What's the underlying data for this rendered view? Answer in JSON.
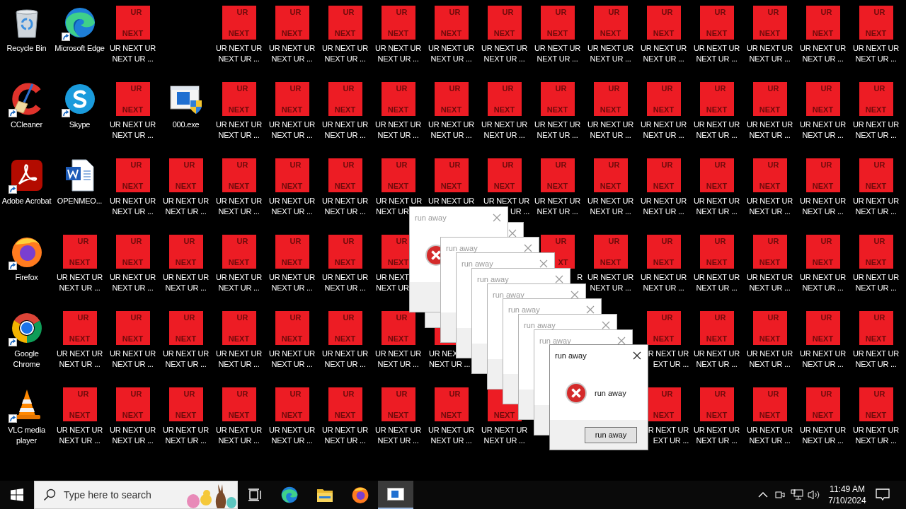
{
  "desktop": {
    "rows": [
      [
        {
          "kind": "recycle",
          "label": "Recycle Bin",
          "shortcut": false
        },
        {
          "kind": "edge",
          "label": "Microsoft Edge",
          "shortcut": true
        },
        {
          "kind": "ur",
          "badge_top": "UR",
          "badge_bottom": "NEXT",
          "label": "UR NEXT UR NEXT UR ...",
          "shortcut": false
        },
        null,
        {
          "kind": "ur",
          "badge_top": "UR",
          "badge_bottom": "NEXT",
          "label": "UR NEXT UR NEXT UR ...",
          "shortcut": false
        },
        {
          "kind": "ur",
          "badge_top": "UR",
          "badge_bottom": "NEXT",
          "label": "UR NEXT UR NEXT UR ...",
          "shortcut": false
        },
        {
          "kind": "ur",
          "badge_top": "UR",
          "badge_bottom": "NEXT",
          "label": "UR NEXT UR NEXT UR ...",
          "shortcut": false
        },
        {
          "kind": "ur",
          "badge_top": "UR",
          "badge_bottom": "NEXT",
          "label": "UR NEXT UR NEXT UR ...",
          "shortcut": false
        },
        {
          "kind": "ur",
          "badge_top": "UR",
          "badge_bottom": "NEXT",
          "label": "UR NEXT UR NEXT UR ...",
          "shortcut": false
        },
        {
          "kind": "ur",
          "badge_top": "UR",
          "badge_bottom": "NEXT",
          "label": "UR NEXT UR NEXT UR ...",
          "shortcut": false
        },
        {
          "kind": "ur",
          "badge_top": "UR",
          "badge_bottom": "NEXT",
          "label": "UR NEXT UR NEXT UR ...",
          "shortcut": false
        },
        {
          "kind": "ur",
          "badge_top": "UR",
          "badge_bottom": "NEXT",
          "label": "UR NEXT UR NEXT UR ...",
          "shortcut": false
        },
        {
          "kind": "ur",
          "badge_top": "UR",
          "badge_bottom": "NEXT",
          "label": "UR NEXT UR NEXT UR ...",
          "shortcut": false
        },
        {
          "kind": "ur",
          "badge_top": "UR",
          "badge_bottom": "NEXT",
          "label": "UR NEXT UR NEXT UR ...",
          "shortcut": false
        },
        {
          "kind": "ur",
          "badge_top": "UR",
          "badge_bottom": "NEXT",
          "label": "UR NEXT UR NEXT UR ...",
          "shortcut": false
        },
        {
          "kind": "ur",
          "badge_top": "UR",
          "badge_bottom": "NEXT",
          "label": "UR NEXT UR NEXT UR ...",
          "shortcut": false
        },
        {
          "kind": "ur",
          "badge_top": "UR",
          "badge_bottom": "NEXT",
          "label": "UR NEXT UR NEXT UR ...",
          "shortcut": false
        }
      ],
      [
        {
          "kind": "ccleaner",
          "label": "CCleaner",
          "shortcut": true
        },
        {
          "kind": "skype",
          "label": "Skype",
          "shortcut": true
        },
        {
          "kind": "ur",
          "badge_top": "UR",
          "badge_bottom": "NEXT",
          "label": "UR NEXT UR NEXT UR ...",
          "shortcut": false
        },
        {
          "kind": "exe",
          "label": "000.exe",
          "shortcut": false
        },
        {
          "kind": "ur",
          "badge_top": "UR",
          "badge_bottom": "NEXT",
          "label": "UR NEXT UR NEXT UR ...",
          "shortcut": false
        },
        {
          "kind": "ur",
          "badge_top": "UR",
          "badge_bottom": "NEXT",
          "label": "UR NEXT UR NEXT UR ...",
          "shortcut": false
        },
        {
          "kind": "ur",
          "badge_top": "UR",
          "badge_bottom": "NEXT",
          "label": "UR NEXT UR NEXT UR ...",
          "shortcut": false
        },
        {
          "kind": "ur",
          "badge_top": "UR",
          "badge_bottom": "NEXT",
          "label": "UR NEXT UR NEXT UR ...",
          "shortcut": false
        },
        {
          "kind": "ur",
          "badge_top": "UR",
          "badge_bottom": "NEXT",
          "label": "UR NEXT UR NEXT UR ...",
          "shortcut": false
        },
        {
          "kind": "ur",
          "badge_top": "UR",
          "badge_bottom": "NEXT",
          "label": "UR NEXT UR NEXT UR ...",
          "shortcut": false
        },
        {
          "kind": "ur",
          "badge_top": "UR",
          "badge_bottom": "NEXT",
          "label": "UR NEXT UR NEXT UR ...",
          "shortcut": false
        },
        {
          "kind": "ur",
          "badge_top": "UR",
          "badge_bottom": "NEXT",
          "label": "UR NEXT UR NEXT UR ...",
          "shortcut": false
        },
        {
          "kind": "ur",
          "badge_top": "UR",
          "badge_bottom": "NEXT",
          "label": "UR NEXT UR NEXT UR ...",
          "shortcut": false
        },
        {
          "kind": "ur",
          "badge_top": "UR",
          "badge_bottom": "NEXT",
          "label": "UR NEXT UR NEXT UR ...",
          "shortcut": false
        },
        {
          "kind": "ur",
          "badge_top": "UR",
          "badge_bottom": "NEXT",
          "label": "UR NEXT UR NEXT UR ...",
          "shortcut": false
        },
        {
          "kind": "ur",
          "badge_top": "UR",
          "badge_bottom": "NEXT",
          "label": "UR NEXT UR NEXT UR ...",
          "shortcut": false
        },
        {
          "kind": "ur",
          "badge_top": "UR",
          "badge_bottom": "NEXT",
          "label": "UR NEXT UR NEXT UR ...",
          "shortcut": false
        }
      ],
      [
        {
          "kind": "acrobat",
          "label": "Adobe Acrobat",
          "shortcut": true
        },
        {
          "kind": "word",
          "label": "OPENMEO...",
          "shortcut": false
        },
        {
          "kind": "ur",
          "badge_top": "UR",
          "badge_bottom": "NEXT",
          "label": "UR NEXT UR NEXT UR ...",
          "shortcut": false
        },
        {
          "kind": "ur",
          "badge_top": "UR",
          "badge_bottom": "NEXT",
          "label": "UR NEXT UR NEXT UR ...",
          "shortcut": false
        },
        {
          "kind": "ur",
          "badge_top": "UR",
          "badge_bottom": "NEXT",
          "label": "UR NEXT UR NEXT UR ...",
          "shortcut": false
        },
        {
          "kind": "ur",
          "badge_top": "UR",
          "badge_bottom": "NEXT",
          "label": "UR NEXT UR NEXT UR ...",
          "shortcut": false
        },
        {
          "kind": "ur",
          "badge_top": "UR",
          "badge_bottom": "NEXT",
          "label": "UR NEXT UR NEXT UR ...",
          "shortcut": false
        },
        {
          "kind": "ur",
          "badge_top": "UR",
          "badge_bottom": "NEXT",
          "label": "UR NEXT UR\nNEXT UR",
          "shortcut": false
        },
        {
          "kind": "ur",
          "badge_top": "UR",
          "badge_bottom": "NEXT",
          "label": "UR NEXT UR",
          "shortcut": false
        },
        {
          "kind": "ur",
          "badge_top": "UR",
          "badge_bottom": "NEXT",
          "label": "UR NEXT UR\nUR ...",
          "shortcut": false
        },
        {
          "kind": "ur",
          "badge_top": "UR",
          "badge_bottom": "NEXT",
          "label": "UR NEXT UR NEXT UR ...",
          "shortcut": false
        },
        {
          "kind": "ur",
          "badge_top": "UR",
          "badge_bottom": "NEXT",
          "label": "UR NEXT UR NEXT UR ...",
          "shortcut": false
        },
        {
          "kind": "ur",
          "badge_top": "UR",
          "badge_bottom": "NEXT",
          "label": "UR NEXT UR NEXT UR ...",
          "shortcut": false
        },
        {
          "kind": "ur",
          "badge_top": "UR",
          "badge_bottom": "NEXT",
          "label": "UR NEXT UR NEXT UR ...",
          "shortcut": false
        },
        {
          "kind": "ur",
          "badge_top": "UR",
          "badge_bottom": "NEXT",
          "label": "UR NEXT UR NEXT UR ...",
          "shortcut": false
        },
        {
          "kind": "ur",
          "badge_top": "UR",
          "badge_bottom": "NEXT",
          "label": "UR NEXT UR NEXT UR ...",
          "shortcut": false
        },
        {
          "kind": "ur",
          "badge_top": "UR",
          "badge_bottom": "NEXT",
          "label": "UR NEXT UR NEXT UR ...",
          "shortcut": false
        }
      ],
      [
        {
          "kind": "firefox",
          "label": "Firefox",
          "shortcut": true
        },
        {
          "kind": "ur",
          "badge_top": "UR",
          "badge_bottom": "NEXT",
          "label": "UR NEXT UR NEXT UR ...",
          "shortcut": false
        },
        {
          "kind": "ur",
          "badge_top": "UR",
          "badge_bottom": "NEXT",
          "label": "UR NEXT UR NEXT UR ...",
          "shortcut": false
        },
        {
          "kind": "ur",
          "badge_top": "UR",
          "badge_bottom": "NEXT",
          "label": "UR NEXT UR NEXT UR ...",
          "shortcut": false
        },
        {
          "kind": "ur",
          "badge_top": "UR",
          "badge_bottom": "NEXT",
          "label": "UR NEXT UR NEXT UR ...",
          "shortcut": false
        },
        {
          "kind": "ur",
          "badge_top": "UR",
          "badge_bottom": "NEXT",
          "label": "UR NEXT UR NEXT UR ...",
          "shortcut": false
        },
        {
          "kind": "ur",
          "badge_top": "UR",
          "badge_bottom": "NEXT",
          "label": "UR NEXT UR NEXT UR ...",
          "shortcut": false
        },
        {
          "kind": "ur",
          "badge_top": "UR",
          "badge_bottom": "NEXT",
          "label": "UR NEXT\nNEXT UR",
          "shortcut": false
        },
        null,
        null,
        {
          "kind": "ur",
          "badge_top": "UR",
          "badge_bottom": "XT",
          "label": "R",
          "shortcut": false
        },
        {
          "kind": "ur",
          "badge_top": "UR",
          "badge_bottom": "NEXT",
          "label": "UR NEXT UR NEXT UR ...",
          "shortcut": false
        },
        {
          "kind": "ur",
          "badge_top": "UR",
          "badge_bottom": "NEXT",
          "label": "UR NEXT UR NEXT UR ...",
          "shortcut": false
        },
        {
          "kind": "ur",
          "badge_top": "UR",
          "badge_bottom": "NEXT",
          "label": "UR NEXT UR NEXT UR ...",
          "shortcut": false
        },
        {
          "kind": "ur",
          "badge_top": "UR",
          "badge_bottom": "NEXT",
          "label": "UR NEXT UR NEXT UR ...",
          "shortcut": false
        },
        {
          "kind": "ur",
          "badge_top": "UR",
          "badge_bottom": "NEXT",
          "label": "UR NEXT UR NEXT UR ...",
          "shortcut": false
        },
        {
          "kind": "ur",
          "badge_top": "UR",
          "badge_bottom": "NEXT",
          "label": "UR NEXT UR NEXT UR ...",
          "shortcut": false
        }
      ],
      [
        {
          "kind": "chrome",
          "label": "Google Chrome",
          "shortcut": true
        },
        {
          "kind": "ur",
          "badge_top": "UR",
          "badge_bottom": "NEXT",
          "label": "UR NEXT UR NEXT UR ...",
          "shortcut": false
        },
        {
          "kind": "ur",
          "badge_top": "UR",
          "badge_bottom": "NEXT",
          "label": "UR NEXT UR NEXT UR ...",
          "shortcut": false
        },
        {
          "kind": "ur",
          "badge_top": "UR",
          "badge_bottom": "NEXT",
          "label": "UR NEXT UR NEXT UR ...",
          "shortcut": false
        },
        {
          "kind": "ur",
          "badge_top": "UR",
          "badge_bottom": "NEXT",
          "label": "UR NEXT UR NEXT UR ...",
          "shortcut": false
        },
        {
          "kind": "ur",
          "badge_top": "UR",
          "badge_bottom": "NEXT",
          "label": "UR NEXT UR NEXT UR ...",
          "shortcut": false
        },
        {
          "kind": "ur",
          "badge_top": "UR",
          "badge_bottom": "NEXT",
          "label": "UR NEXT UR NEXT UR ...",
          "shortcut": false
        },
        {
          "kind": "ur",
          "badge_top": "UR",
          "badge_bottom": "NEXT",
          "label": "UR NEXT UR NEXT UR ...",
          "shortcut": false
        },
        {
          "kind": "ur",
          "label": "UR NEX\nNEXT UR ...",
          "shortcut": false
        },
        null,
        null,
        null,
        {
          "kind": "ur",
          "badge_top": "UR",
          "badge_bottom": "NEXT",
          "label": "R NEXT UR\nEXT UR ...",
          "shortcut": false
        },
        {
          "kind": "ur",
          "badge_top": "UR",
          "badge_bottom": "NEXT",
          "label": "UR NEXT UR NEXT UR ...",
          "shortcut": false
        },
        {
          "kind": "ur",
          "badge_top": "UR",
          "badge_bottom": "NEXT",
          "label": "UR NEXT UR NEXT UR ...",
          "shortcut": false
        },
        {
          "kind": "ur",
          "badge_top": "UR",
          "badge_bottom": "NEXT",
          "label": "UR NEXT UR NEXT UR ...",
          "shortcut": false
        },
        {
          "kind": "ur",
          "badge_top": "UR",
          "badge_bottom": "NEXT",
          "label": "UR NEXT UR NEXT UR ...",
          "shortcut": false
        }
      ],
      [
        {
          "kind": "vlc",
          "label": "VLC media player",
          "shortcut": true
        },
        {
          "kind": "ur",
          "badge_top": "UR",
          "badge_bottom": "NEXT",
          "label": "UR NEXT UR NEXT UR ...",
          "shortcut": false
        },
        {
          "kind": "ur",
          "badge_top": "UR",
          "badge_bottom": "NEXT",
          "label": "UR NEXT UR NEXT UR ...",
          "shortcut": false
        },
        {
          "kind": "ur",
          "badge_top": "UR",
          "badge_bottom": "NEXT",
          "label": "UR NEXT UR NEXT UR ...",
          "shortcut": false
        },
        {
          "kind": "ur",
          "badge_top": "UR",
          "badge_bottom": "NEXT",
          "label": "UR NEXT UR NEXT UR ...",
          "shortcut": false
        },
        {
          "kind": "ur",
          "badge_top": "UR",
          "badge_bottom": "NEXT",
          "label": "UR NEXT UR NEXT UR ...",
          "shortcut": false
        },
        {
          "kind": "ur",
          "badge_top": "UR",
          "badge_bottom": "NEXT",
          "label": "UR NEXT UR NEXT UR ...",
          "shortcut": false
        },
        {
          "kind": "ur",
          "badge_top": "UR",
          "badge_bottom": "NEXT",
          "label": "UR NEXT UR NEXT UR ...",
          "shortcut": false
        },
        {
          "kind": "ur",
          "badge_top": "UR",
          "badge_bottom": "NEXT",
          "label": "UR NEXT UR NEXT UR ...",
          "shortcut": false
        },
        {
          "kind": "ur",
          "badge_bottom": "NEXT",
          "label": "UR NEXT UR NEXT UR ...",
          "shortcut": false
        },
        null,
        null,
        {
          "kind": "ur",
          "badge_top": "UR",
          "badge_bottom": "NEXT",
          "label": "R NEXT UR\nEXT UR ...",
          "shortcut": false
        },
        {
          "kind": "ur",
          "badge_top": "UR",
          "badge_bottom": "NEXT",
          "label": "UR NEXT UR NEXT UR ...",
          "shortcut": false
        },
        {
          "kind": "ur",
          "badge_top": "UR",
          "badge_bottom": "NEXT",
          "label": "UR NEXT UR NEXT UR ...",
          "shortcut": false
        },
        {
          "kind": "ur",
          "badge_top": "UR",
          "badge_bottom": "NEXT",
          "label": "UR NEXT UR NEXT UR ...",
          "shortcut": false
        },
        {
          "kind": "ur",
          "badge_top": "UR",
          "badge_bottom": "NEXT",
          "label": "UR NEXT UR NEXT UR ...",
          "shortcut": false
        }
      ]
    ]
  },
  "dialogs": [
    {
      "title": "run away",
      "active": false
    },
    {
      "active": false
    },
    {
      "title": "run away",
      "active": false
    },
    {
      "title": "run away",
      "active": false
    },
    {
      "title": "run away",
      "active": false
    },
    {
      "title": "run away",
      "active": false
    },
    {
      "title": "run away",
      "active": false
    },
    {
      "title": "run away",
      "active": false
    },
    {
      "title": "run away",
      "active": false
    },
    {
      "title": "run away",
      "active": true,
      "message": "run away",
      "button": "run away"
    }
  ],
  "taskbar": {
    "search": {
      "placeholder": "Type here to search"
    },
    "apps": [
      {
        "kind": "edge",
        "selected": false
      },
      {
        "kind": "explorer",
        "selected": false
      },
      {
        "kind": "firefox",
        "selected": false
      },
      {
        "kind": "window",
        "selected": true
      }
    ],
    "clock": {
      "time": "11:49 AM",
      "date": "7/10/2024"
    }
  }
}
